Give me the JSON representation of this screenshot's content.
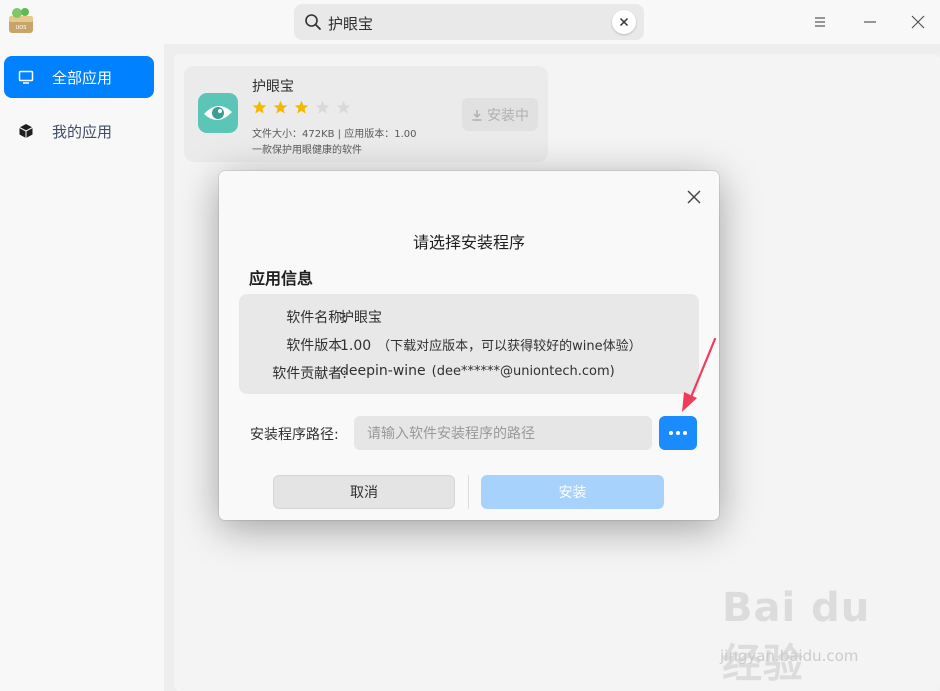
{
  "titlebar": {
    "logo_text": "UOS",
    "search_value": "护眼宝",
    "icons": [
      "search-icon",
      "clear-icon",
      "menu-icon",
      "minimize-icon",
      "close-icon"
    ]
  },
  "sidebar": {
    "items": [
      {
        "label": "全部应用",
        "icon": "monitor-icon",
        "active": true
      },
      {
        "label": "我的应用",
        "icon": "box-icon",
        "active": false
      }
    ]
  },
  "app_card": {
    "name": "护眼宝",
    "rating": 3,
    "max_rating": 5,
    "meta": "文件大小：472KB | 应用版本：1.00",
    "description": "一款保护用眼健康的软件",
    "button_label": "安装中"
  },
  "dialog": {
    "title": "请选择安装程序",
    "section_title": "应用信息",
    "info": {
      "name_label": "软件名称:",
      "name_value": "护眼宝",
      "version_label": "软件版本:",
      "version_value": "1.00",
      "version_note": "（下载对应版本，可以获得较好的wine体验）",
      "contributor_label": "软件贡献者:",
      "contributor_value": "deepin-wine",
      "contributor_note": "(dee******@uniontech.com)"
    },
    "path_label": "安装程序路径:",
    "path_placeholder": "请输入软件安装程序的路径",
    "cancel_label": "取消",
    "install_label": "安装"
  },
  "watermark": {
    "logo": "Bai du 经验",
    "url": "jingyan.baidu.com"
  },
  "colors": {
    "accent": "#0081ff",
    "browse_button": "#1a8cff",
    "install_disabled": "#a6d2fb",
    "star_filled": "#f5b800",
    "star_empty": "#d9d9d9",
    "arrow": "#f03c5a"
  }
}
